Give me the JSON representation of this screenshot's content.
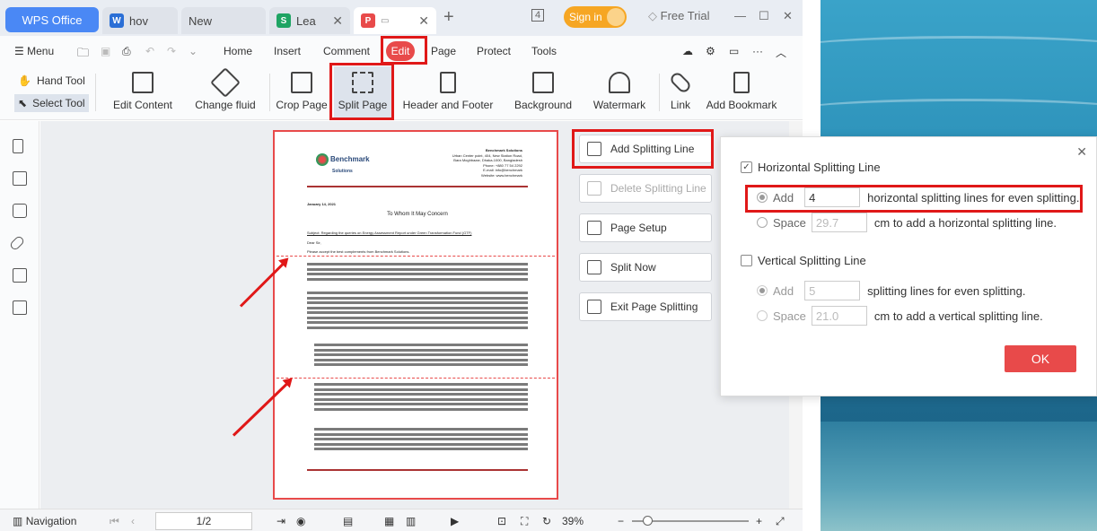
{
  "app": {
    "wps_tab": "WPS Office",
    "tabs": [
      {
        "label": "hov",
        "icon": "writer-icon",
        "color": "#2b6fd6"
      },
      {
        "label": "New",
        "icon": "",
        "color": ""
      },
      {
        "label": "Lea",
        "icon": "sheet-icon",
        "color": "#1fa463"
      },
      {
        "label": "",
        "icon": "pdf-icon",
        "color": "#e84a4a"
      }
    ],
    "tab_count": "4",
    "signin": "Sign in",
    "free_trial": "Free Trial"
  },
  "menubar": {
    "menu": "Menu",
    "items": [
      "Home",
      "Insert",
      "Comment",
      "Edit",
      "Page",
      "Protect",
      "Tools"
    ]
  },
  "ribbon": {
    "hand_tool": "Hand Tool",
    "select_tool": "Select Tool",
    "buttons": [
      "Edit Content",
      "Change fluid",
      "Crop Page",
      "Split Page",
      "Header and Footer",
      "Background",
      "Watermark",
      "Link",
      "Add Bookmark"
    ]
  },
  "panel": {
    "add_line": "Add Splitting Line",
    "delete_line": "Delete Splitting Line",
    "page_setup": "Page Setup",
    "split_now": "Split Now",
    "exit": "Exit Page Splitting"
  },
  "dialog": {
    "horizontal_label": "Horizontal Splitting Line",
    "h_add": "Add",
    "h_add_value": "4",
    "h_add_suffix": "horizontal splitting lines for even splitting.",
    "h_space": "Space",
    "h_space_value": "29.7",
    "h_space_suffix": "cm to add a horizontal splitting line.",
    "vertical_label": "Vertical Splitting Line",
    "v_add": "Add",
    "v_add_value": "5",
    "v_add_suffix": "splitting lines for even splitting.",
    "v_space": "Space",
    "v_space_value": "21.0",
    "v_space_suffix": "cm to add a vertical splitting line.",
    "ok": "OK"
  },
  "document": {
    "logo": "Benchmark",
    "logo_sub": "Solutions",
    "address": [
      "Benchmark Solutions",
      "Urban Center point, 404, New Station Road,",
      "Bara Moghbazar, Dhaka-1000, Bangladesh",
      "Phone: +880 77 54 2292",
      "E-mail: info@benchmark",
      "Website: www.benchmark"
    ],
    "date": "January 14, 2021",
    "heading": "To Whom It May Concern",
    "subject": "Subject: Regarding the queries on Energy Assessment Report under Green Transformation Fund (GTF)",
    "salutation": "Dear Sir,",
    "greeting": "Please accept the best complements from Benchmark Solutions."
  },
  "status": {
    "navigation": "Navigation",
    "page": "1/2",
    "zoom": "39%"
  }
}
